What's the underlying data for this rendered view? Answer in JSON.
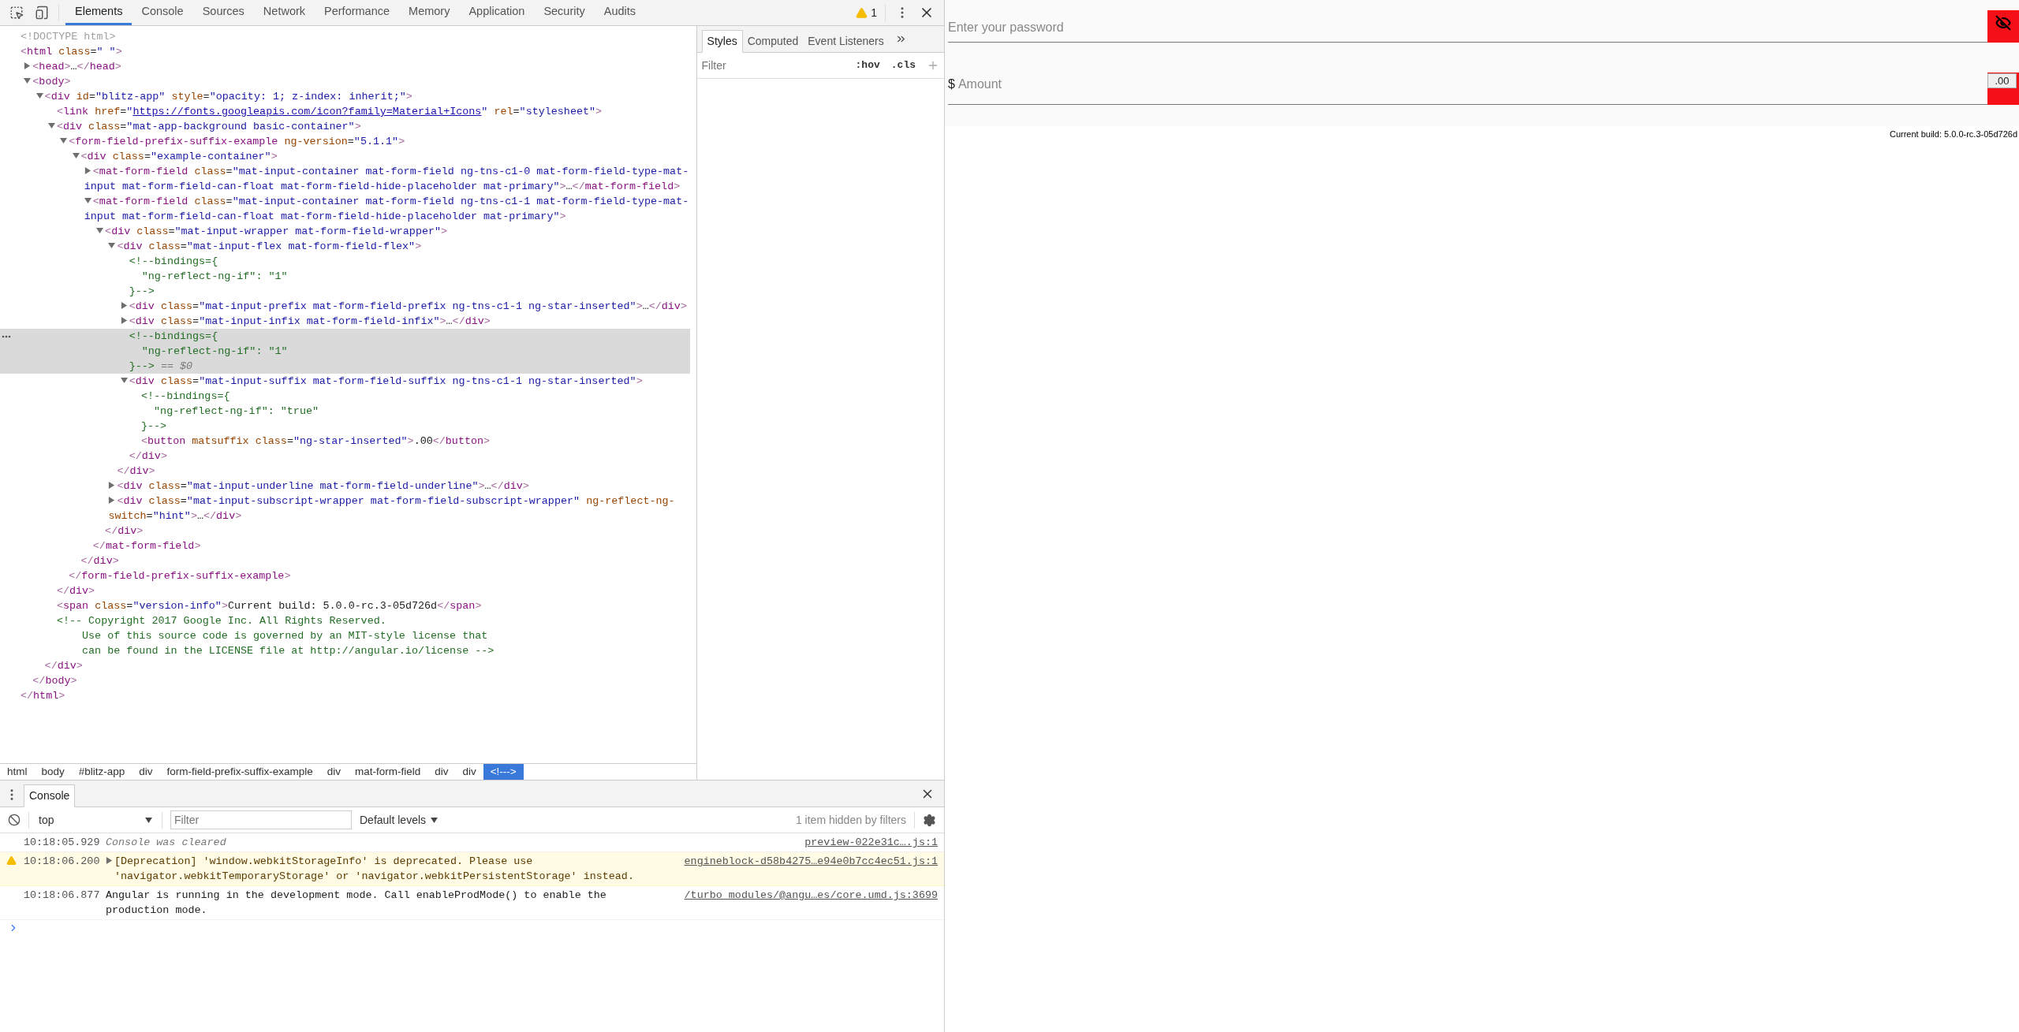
{
  "toolbar": {
    "tabs": [
      {
        "label": "Elements",
        "selected": true
      },
      {
        "label": "Console",
        "selected": false
      },
      {
        "label": "Sources",
        "selected": false
      },
      {
        "label": "Network",
        "selected": false
      },
      {
        "label": "Performance",
        "selected": false
      },
      {
        "label": "Memory",
        "selected": false
      },
      {
        "label": "Application",
        "selected": false
      },
      {
        "label": "Security",
        "selected": false
      },
      {
        "label": "Audits",
        "selected": false
      }
    ],
    "warnings": "1"
  },
  "tree": [
    {
      "text": "<!DOCTYPE html>",
      "selected": false
    },
    {
      "text": "<html class=\" \">",
      "selected": false,
      "close": "</html>",
      "children": [
        {
          "text": "<head>…</head>",
          "expanded": false,
          "selected": false
        },
        {
          "text": "<body>",
          "expanded": true,
          "selected": false,
          "close": "</body>",
          "children": [
            {
              "text": "<div id=\"blitz-app\" style=\"opacity: 1; z-index: inherit;\">",
              "expanded": true,
              "selected": false,
              "close": "</div>",
              "children": [
                {
                  "text": "<link href=\"https://fonts.googleapis.com/icon?family=Material+Icons\" rel=\"stylesheet\">",
                  "selected": false
                },
                {
                  "text": "<div class=\"mat-app-background basic-container\">",
                  "expanded": true,
                  "selected": false,
                  "close": "</div>",
                  "children": [
                    {
                      "text": "<form-field-prefix-suffix-example ng-version=\"5.1.1\">",
                      "expanded": true,
                      "selected": false,
                      "close": "</form-field-prefix-suffix-example>",
                      "children": [
                        {
                          "text": "<div class=\"example-container\">",
                          "expanded": true,
                          "selected": false,
                          "close": "</div>",
                          "children": [
                            {
                              "text": "<mat-form-field class=\"mat-input-container mat-form-field ng-tns-c1-0 mat-form-field-type-mat-input mat-form-field-can-float mat-form-field-hide-placeholder mat-primary\">…</mat-form-field>",
                              "expanded": false,
                              "selected": false
                            },
                            {
                              "text": "<mat-form-field class=\"mat-input-container mat-form-field ng-tns-c1-1 mat-form-field-type-mat-input mat-form-field-can-float mat-form-field-hide-placeholder mat-primary\">",
                              "expanded": true,
                              "selected": false,
                              "close": "</mat-form-field>",
                              "children": [
                                {
                                  "text": "<div class=\"mat-input-wrapper mat-form-field-wrapper\">",
                                  "expanded": true,
                                  "selected": false,
                                  "close": "</div>",
                                  "children": [
                                    {
                                      "text": "<div class=\"mat-input-flex mat-form-field-flex\">",
                                      "expanded": true,
                                      "selected": false,
                                      "close": "</div>",
                                      "children": [
                                        {
                                          "text": "<!--bindings={\n  \"ng-reflect-ng-if\": \"1\"\n}-->",
                                          "selected": false
                                        },
                                        {
                                          "text": "<div class=\"mat-input-prefix mat-form-field-prefix ng-tns-c1-1 ng-star-inserted\">…</div>",
                                          "expanded": false,
                                          "selected": false
                                        },
                                        {
                                          "text": "<div class=\"mat-input-infix mat-form-field-infix\">…</div>",
                                          "expanded": false,
                                          "selected": false
                                        },
                                        {
                                          "text": "<!--bindings={\n  \"ng-reflect-ng-if\": \"1\"\n}-->",
                                          "selected": true,
                                          "console_ref": "== $0"
                                        },
                                        {
                                          "text": "<div class=\"mat-input-suffix mat-form-field-suffix ng-tns-c1-1 ng-star-inserted\">",
                                          "expanded": true,
                                          "selected": false,
                                          "close": "</div>",
                                          "children": [
                                            {
                                              "text": "<!--bindings={\n  \"ng-reflect-ng-if\": \"true\"\n}-->",
                                              "selected": false
                                            },
                                            {
                                              "text": "<button matsuffix class=\"ng-star-inserted\">.00</button>",
                                              "selected": false
                                            }
                                          ]
                                        }
                                      ]
                                    },
                                    {
                                      "text": "<div class=\"mat-input-underline mat-form-field-underline\">…</div>",
                                      "expanded": false,
                                      "selected": false
                                    },
                                    {
                                      "text": "<div class=\"mat-input-subscript-wrapper mat-form-field-subscript-wrapper\" ng-reflect-ng-switch=\"hint\">…</div>",
                                      "expanded": false,
                                      "selected": false
                                    }
                                  ]
                                }
                              ]
                            }
                          ]
                        }
                      ]
                    }
                  ]
                },
                {
                  "text": "<span class=\"version-info\">Current build: 5.0.0-rc.3-05d726d</span>",
                  "selected": false
                },
                {
                  "text": "<!-- Copyright 2017 Google Inc. All Rights Reserved.\n    Use of this source code is governed by an MIT-style license that\n    can be found in the LICENSE file at http://angular.io/license -->",
                  "selected": false
                }
              ]
            }
          ]
        }
      ]
    }
  ],
  "breadcrumbs": [
    {
      "label": "html",
      "selected": false
    },
    {
      "label": "body",
      "selected": false
    },
    {
      "label": "#blitz-app",
      "selected": false
    },
    {
      "label": "div",
      "selected": false
    },
    {
      "label": "form-field-prefix-suffix-example",
      "selected": false
    },
    {
      "label": "div",
      "selected": false
    },
    {
      "label": "mat-form-field",
      "selected": false
    },
    {
      "label": "div",
      "selected": false
    },
    {
      "label": "div",
      "selected": false
    },
    {
      "label": "<!--->",
      "selected": true
    }
  ],
  "styles": {
    "tabs": [
      {
        "label": "Styles",
        "selected": true
      },
      {
        "label": "Computed",
        "selected": false
      },
      {
        "label": "Event Listeners",
        "selected": false
      }
    ],
    "filter_placeholder": "Filter",
    "hov": ":hov",
    "cls": ".cls"
  },
  "console": {
    "tabs": [
      {
        "label": "Console",
        "selected": true
      }
    ],
    "context": "top",
    "filter_placeholder": "Filter",
    "levels": "Default levels",
    "hidden": "1 item hidden by filters",
    "messages": [
      {
        "kind": "cleared",
        "time": "10:18:05.929",
        "text": "Console was cleared",
        "source": "preview-022e31c….js:1"
      },
      {
        "kind": "warning",
        "expanded": false,
        "time": "10:18:06.200",
        "text": "[Deprecation] 'window.webkitStorageInfo' is deprecated. Please use 'navigator.webkitTemporaryStorage' or 'navigator.webkitPersistentStorage' instead.",
        "source": "engineblock-d58b4275…e94e0b7cc4ec51.js:1"
      },
      {
        "kind": "log",
        "time": "10:18:06.877",
        "text": "Angular is running in the development mode. Call enableProdMode() to enable the production mode.",
        "source": "/turbo_modules/@angu…es/core.umd.js:3699"
      }
    ]
  },
  "page": {
    "password_field": {
      "placeholder": "Enter your password"
    },
    "amount_field": {
      "prefix": "$",
      "placeholder": "Amount",
      "suffix_button": ".00"
    },
    "version": "Current build: 5.0.0-rc.3-05d726d"
  }
}
